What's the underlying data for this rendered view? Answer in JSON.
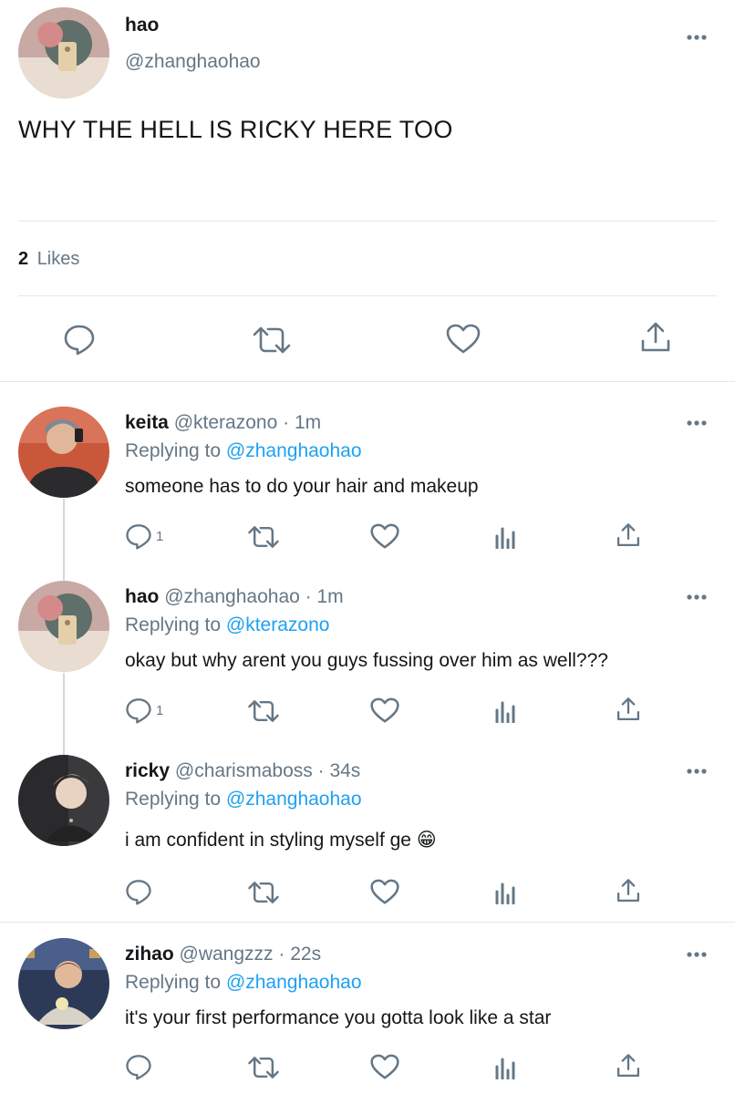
{
  "main_tweet": {
    "display_name": "hao",
    "handle": "@zhanghaohao",
    "text": "WHY THE HELL IS RICKY HERE TOO",
    "likes_count": "2",
    "likes_label": "Likes",
    "actions": [
      "reply-icon",
      "retweet-icon",
      "like-icon",
      "share-icon"
    ]
  },
  "replies": [
    {
      "display_name": "keita",
      "handle": "@kterazono",
      "separator": "·",
      "time": "1m",
      "replying_label": "Replying to",
      "replying_to": "@zhanghaohao",
      "text": "someone has to do your hair and makeup",
      "reply_count": "1"
    },
    {
      "display_name": "hao",
      "handle": "@zhanghaohao",
      "separator": "·",
      "time": "1m",
      "replying_label": "Replying to",
      "replying_to": "@kterazono",
      "text": "okay but why arent you guys fussing over him as well???",
      "reply_count": "1"
    },
    {
      "display_name": "ricky",
      "handle": "@charismaboss",
      "separator": "·",
      "time": "34s",
      "replying_label": "Replying to",
      "replying_to": "@zhanghaohao",
      "text": "i am confident in styling myself ge",
      "emoji": "😁",
      "reply_count": ""
    },
    {
      "display_name": "zihao",
      "handle": "@wangzzz",
      "separator": "·",
      "time": "22s",
      "replying_label": "Replying to",
      "replying_to": "@zhanghaohao",
      "text": "it's your first performance you gotta look like a star",
      "reply_count": ""
    }
  ],
  "colors": {
    "link": "#1da1f2",
    "muted": "#657786",
    "icon": "#657786",
    "divider": "#e1e8ed",
    "thread_line": "#cfd9de"
  }
}
